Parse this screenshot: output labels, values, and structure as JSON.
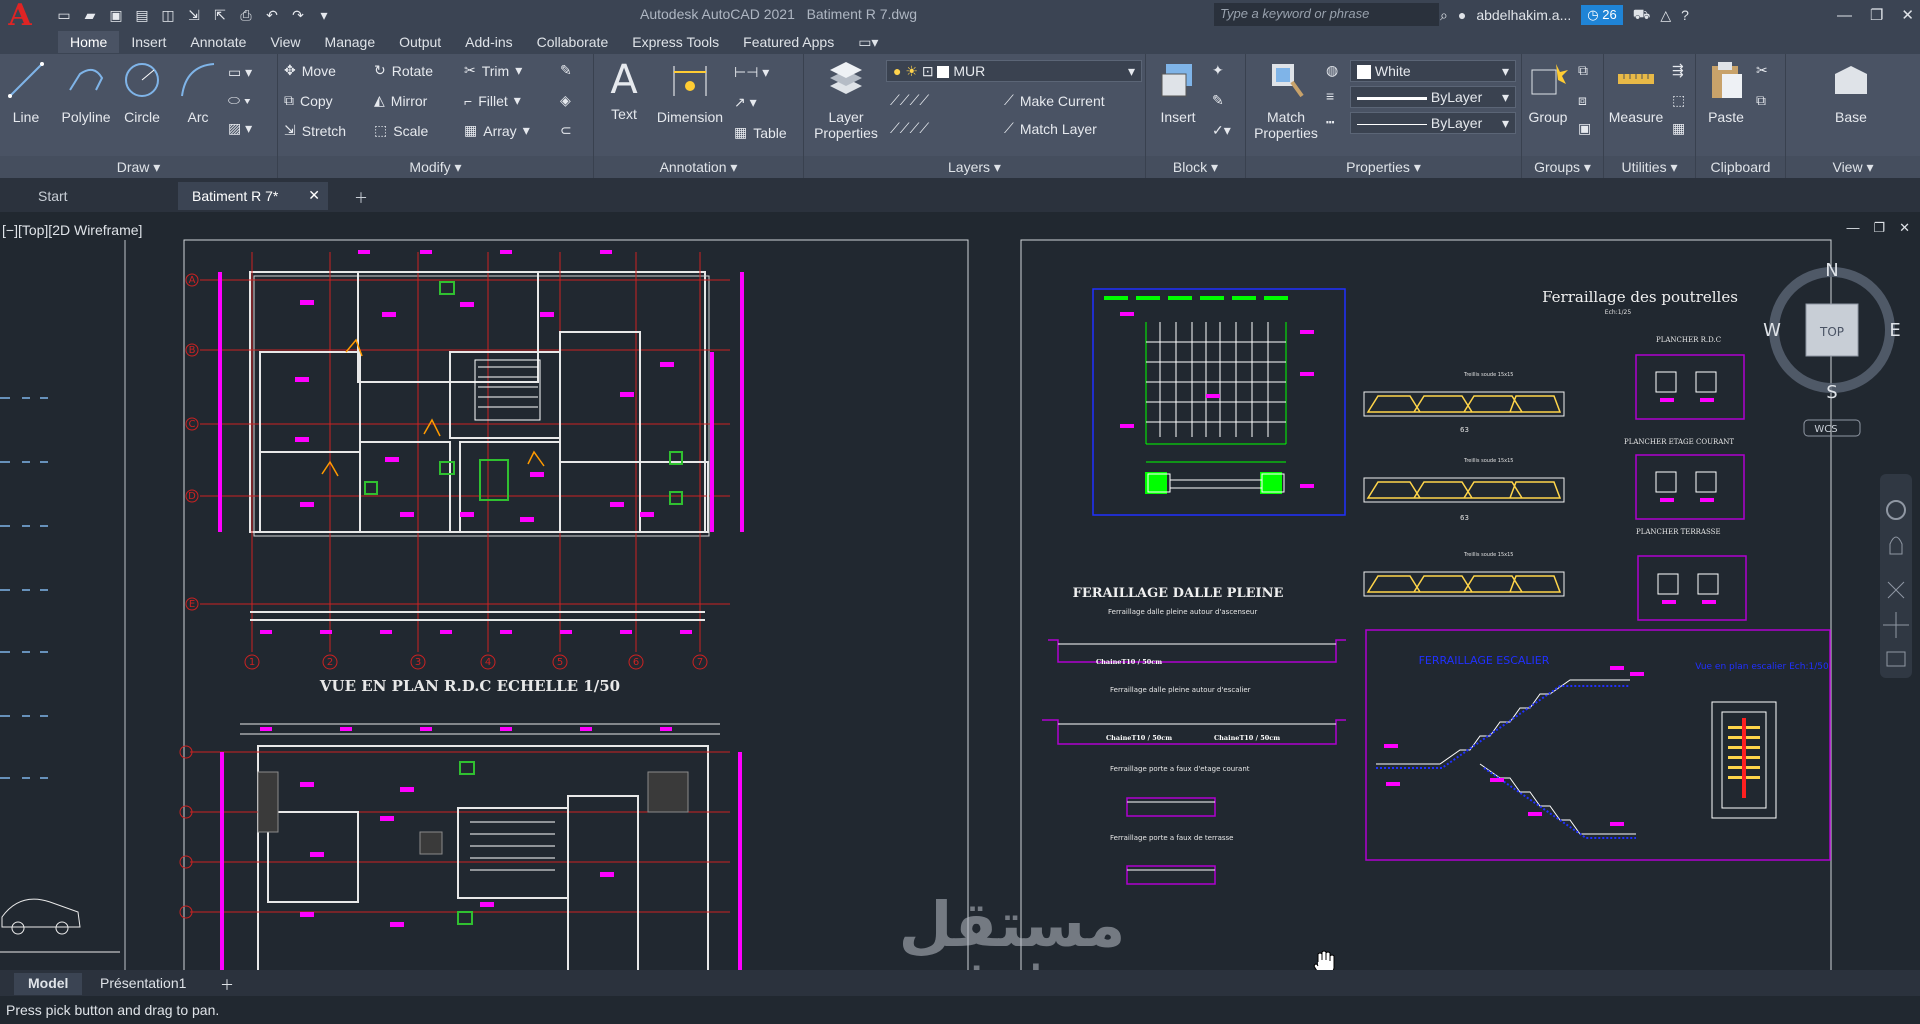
{
  "app": {
    "title": "Autodesk AutoCAD 2021",
    "document": "Batiment R 7.dwg",
    "logo": "A"
  },
  "search": {
    "placeholder": "Type a keyword or phrase"
  },
  "user": {
    "name": "abdelhakim.a...",
    "timer": "26"
  },
  "menu_tabs": [
    "Home",
    "Insert",
    "Annotate",
    "View",
    "Manage",
    "Output",
    "Add-ins",
    "Collaborate",
    "Express Tools",
    "Featured Apps"
  ],
  "ribbon": {
    "draw": {
      "title": "Draw",
      "line": "Line",
      "polyline": "Polyline",
      "circle": "Circle",
      "arc": "Arc"
    },
    "modify": {
      "title": "Modify",
      "move": "Move",
      "rotate": "Rotate",
      "trim": "Trim",
      "copy": "Copy",
      "mirror": "Mirror",
      "fillet": "Fillet",
      "stretch": "Stretch",
      "scale": "Scale",
      "array": "Array"
    },
    "annotation": {
      "title": "Annotation",
      "text": "Text",
      "dimension": "Dimension",
      "table": "Table"
    },
    "layers": {
      "title": "Layers",
      "layer_properties": "Layer Properties",
      "current_layer": "MUR",
      "make_current": "Make Current",
      "match_layer": "Match Layer"
    },
    "block": {
      "title": "Block",
      "insert": "Insert"
    },
    "properties": {
      "title": "Properties",
      "match_properties": "Match Properties",
      "color": "White",
      "linetype": "ByLayer",
      "lineweight": "ByLayer"
    },
    "groups": {
      "title": "Groups",
      "group": "Group"
    },
    "utilities": {
      "title": "Utilities",
      "measure": "Measure"
    },
    "clipboard": {
      "title": "Clipboard",
      "paste": "Paste"
    },
    "view": {
      "title": "View",
      "base": "Base"
    }
  },
  "doc_tabs": {
    "start": "Start",
    "active": "Batiment R 7*"
  },
  "viewport": {
    "label": "[−][Top][2D Wireframe]",
    "plan_title": "VUE EN PLAN R.D.C  ECHELLE 1/50",
    "detail_title": "Ferraillage des poutrelles",
    "detail_scale": "Ech:1/25",
    "dalle_title": "FERAILLAGE DALLE PLEINE",
    "plancher_rdc": "PLANCHER    R.D.C",
    "plancher_etage": "PLANCHER ETAGE COURANT",
    "plancher_terrasse": "PLANCHER TERRASSE",
    "escalier_title": "FERRAILLAGE ESCALIER",
    "escalier_plan": "Vue en plan escalier  Ech:1/50",
    "dalle_asc": "Ferraillage dalle pleine autour d'ascenseur",
    "dalle_esc": "Ferraillage dalle pleine autour d'escalier",
    "porte_etage": "Ferraillage porte a faux d'etage courant",
    "porte_terrasse": "Ferraillage porte a faux de terrasse",
    "chaine1": "ChaineT10 / 50cm",
    "chaine2": "ChaineT10 / 50cm",
    "chaine3": "ChaineT10 / 50cm",
    "treillis": "Treillis soude 15x15",
    "dim63": "63",
    "grid_cols": [
      "1",
      "2",
      "3",
      "4",
      "5",
      "6",
      "7"
    ],
    "grid_rows": [
      "A",
      "B",
      "C",
      "D",
      "E"
    ],
    "compass": {
      "n": "N",
      "s": "S",
      "e": "E",
      "w": "W",
      "top": "TOP",
      "wcs": "WCS"
    },
    "watermark_ar": "مستقل",
    "watermark_en": "mostaql.com"
  },
  "layout_tabs": {
    "model": "Model",
    "presentation": "Présentation1"
  },
  "status": {
    "message": "Press pick button and drag to pan."
  }
}
